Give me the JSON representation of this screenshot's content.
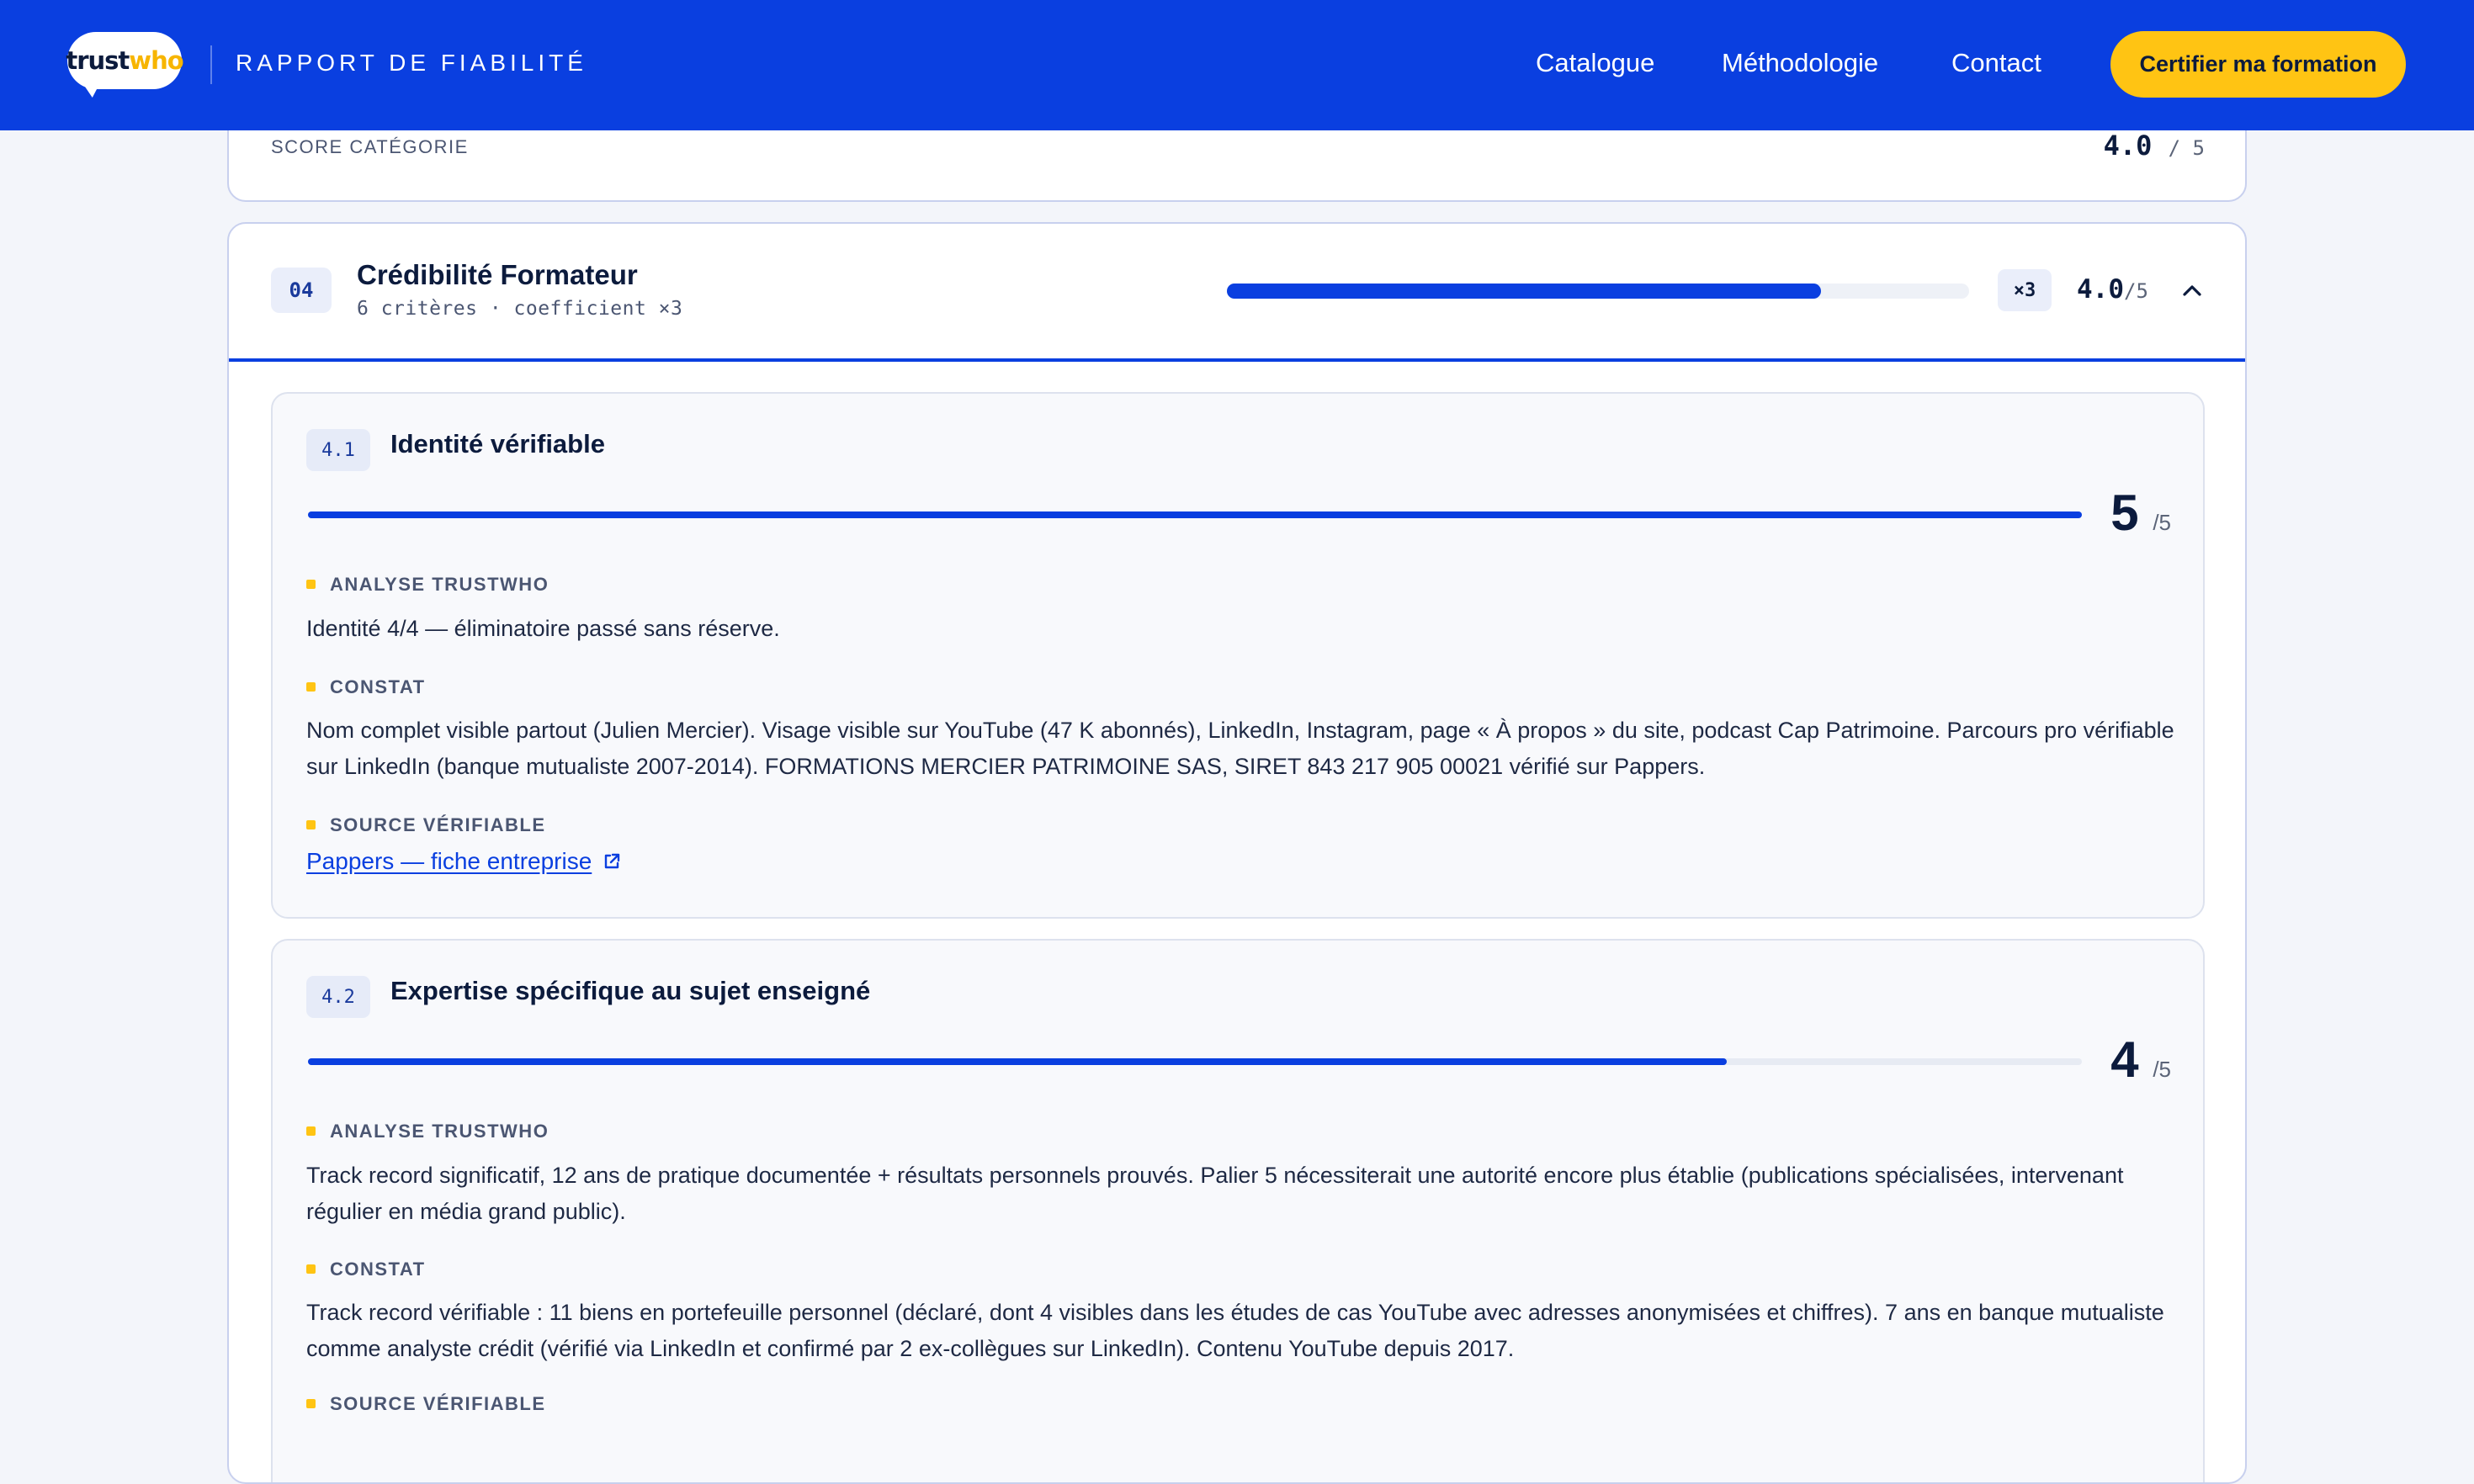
{
  "header": {
    "logo_trust": "trust",
    "logo_who": "who",
    "report_title": "RAPPORT DE FIABILITÉ",
    "nav": [
      "Catalogue",
      "Méthodologie",
      "Contact"
    ],
    "cta": "Certifier ma formation",
    "colors": {
      "bar": "#0a3fe0",
      "cta": "#ffc413"
    }
  },
  "prev_card": {
    "score_label": "SCORE CATÉGORIE",
    "score": "4.0",
    "score_den": "/ 5"
  },
  "category": {
    "number": "04",
    "title": "Crédibilité Formateur",
    "subtitle": "6 critères · coefficient ×3",
    "progress": 0.8,
    "coefficient": "×3",
    "score": "4.0",
    "score_den": "/5",
    "toggle_icon": "chevron-up-icon"
  },
  "criteria": [
    {
      "id": "4.1",
      "title": "Identité vérifiable",
      "score": "5",
      "score_den": "/5",
      "progress": 1.0,
      "analyse_label": "ANALYSE TRUSTWHO",
      "analyse": "Identité 4/4 — éliminatoire passé sans réserve.",
      "constat_label": "CONSTAT",
      "constat": "Nom complet visible partout (Julien Mercier). Visage visible sur YouTube (47 K abonnés), LinkedIn, Instagram, page « À propos » du site, podcast Cap Patrimoine. Parcours pro vérifiable sur LinkedIn (banque mutualiste 2007-2014). FORMATIONS MERCIER PATRIMOINE SAS, SIRET 843 217 905 00021 vérifié sur Pappers.",
      "source_label": "SOURCE VÉRIFIABLE",
      "source_link": "Pappers — fiche entreprise"
    },
    {
      "id": "4.2",
      "title": "Expertise spécifique au sujet enseigné",
      "score": "4",
      "score_den": "/5",
      "progress": 0.8,
      "analyse_label": "ANALYSE TRUSTWHO",
      "analyse": "Track record significatif, 12 ans de pratique documentée + résultats personnels prouvés. Palier 5 nécessiterait une autorité encore plus établie (publications spécialisées, intervenant régulier en média grand public).",
      "constat_label": "CONSTAT",
      "constat": "Track record vérifiable : 11 biens en portefeuille personnel (déclaré, dont 4 visibles dans les études de cas YouTube avec adresses anonymisées et chiffres). 7 ans en banque mutualiste comme analyste crédit (vérifié via LinkedIn et confirmé par 2 ex-collègues sur LinkedIn). Contenu YouTube depuis 2017.",
      "source_label": "SOURCE VÉRIFIABLE"
    }
  ]
}
